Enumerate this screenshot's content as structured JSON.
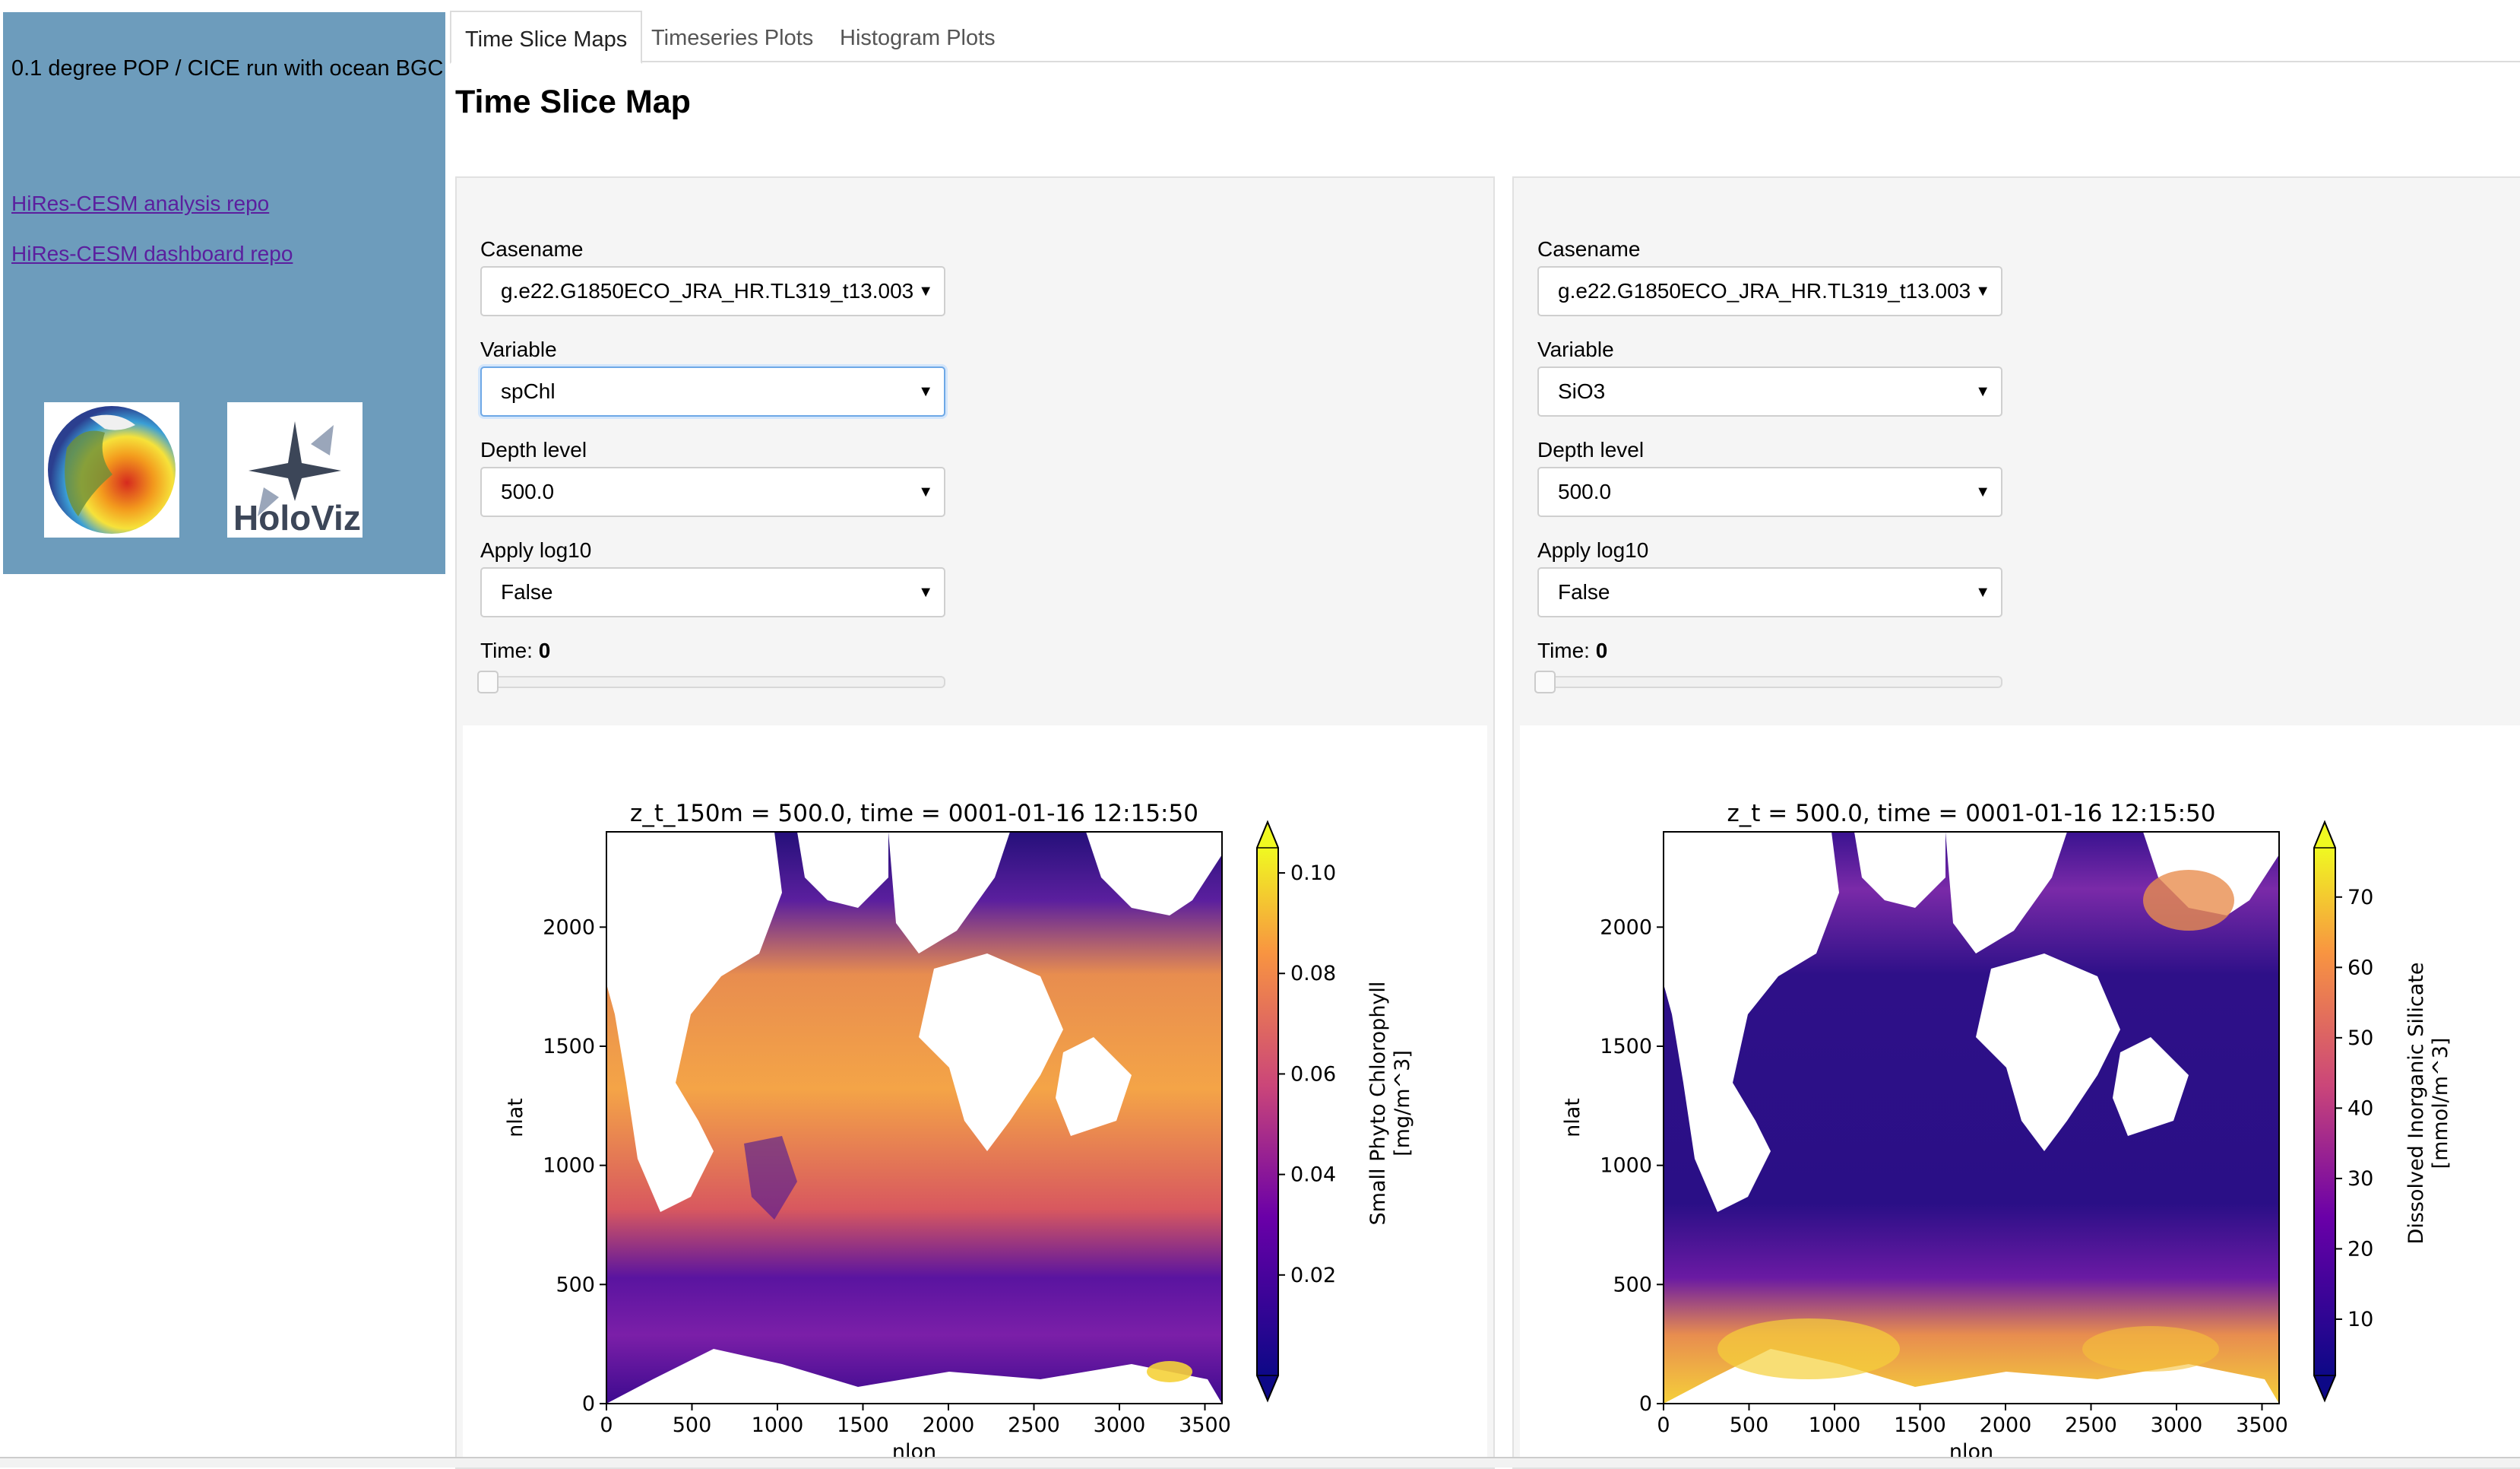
{
  "sidebar": {
    "title": "0.1 degree POP / CICE run with ocean BGC",
    "links": [
      "HiRes-CESM analysis repo",
      "HiRes-CESM dashboard repo"
    ],
    "logo_text": "HoloViz"
  },
  "tabs": [
    "Time Slice Maps",
    "Timeseries Plots",
    "Histogram Plots"
  ],
  "page_title": "Time Slice Map",
  "panels": [
    {
      "casename_label": "Casename",
      "casename_value": "g.e22.G1850ECO_JRA_HR.TL319_t13.003",
      "variable_label": "Variable",
      "variable_value": "spChl",
      "depth_label": "Depth level",
      "depth_value": "500.0",
      "log_label": "Apply log10",
      "log_value": "False",
      "time_label": "Time:",
      "time_value": "0",
      "plot_title": "z_t_150m = 500.0, time = 0001-01-16 12:15:50",
      "colorbar_label_1": "Small Phyto Chlorophyll",
      "colorbar_label_2": "[mg/m^3]"
    },
    {
      "casename_label": "Casename",
      "casename_value": "g.e22.G1850ECO_JRA_HR.TL319_t13.003",
      "variable_label": "Variable",
      "variable_value": "SiO3",
      "depth_label": "Depth level",
      "depth_value": "500.0",
      "log_label": "Apply log10",
      "log_value": "False",
      "time_label": "Time:",
      "time_value": "0",
      "plot_title": "z_t = 500.0, time = 0001-01-16 12:15:50",
      "colorbar_label_1": "Dissolved Inorganic Silicate",
      "colorbar_label_2": "[mmol/m^3]"
    }
  ],
  "chart_data": [
    {
      "type": "heatmap",
      "title": "z_t_150m = 500.0, time = 0001-01-16 12:15:50",
      "xlabel": "nlon",
      "ylabel": "nlat",
      "xlim": [
        0,
        3600
      ],
      "ylim": [
        0,
        2400
      ],
      "xticks": [
        0,
        500,
        1000,
        1500,
        2000,
        2500,
        3000,
        3500
      ],
      "yticks": [
        0,
        500,
        1000,
        1500,
        2000
      ],
      "colorbar": {
        "label": "Small Phyto Chlorophyll [mg/m^3]",
        "range": [
          0.0,
          0.105
        ],
        "ticks": [
          0.02,
          0.04,
          0.06,
          0.08,
          0.1
        ],
        "tick_labels": [
          "0.02",
          "0.04",
          "0.06",
          "0.08",
          "0.10"
        ],
        "colormap": "plasma"
      }
    },
    {
      "type": "heatmap",
      "title": "z_t = 500.0, time = 0001-01-16 12:15:50",
      "xlabel": "nlon",
      "ylabel": "nlat",
      "xlim": [
        0,
        3600
      ],
      "ylim": [
        0,
        2400
      ],
      "xticks": [
        0,
        500,
        1000,
        1500,
        2000,
        2500,
        3000,
        3500
      ],
      "yticks": [
        0,
        500,
        1000,
        1500,
        2000
      ],
      "colorbar": {
        "label": "Dissolved Inorganic Silicate [mmol/m^3]",
        "range": [
          2,
          77
        ],
        "ticks": [
          10,
          20,
          30,
          40,
          50,
          60,
          70
        ],
        "tick_labels": [
          "10",
          "20",
          "30",
          "40",
          "50",
          "60",
          "70"
        ],
        "colormap": "plasma"
      }
    }
  ],
  "colors": {
    "sidebar_bg": "#6d9cbc",
    "link": "#5b1f9e",
    "panel_bg": "#f5f5f5",
    "ocean_low": "#1f0c66",
    "ocean_mid": "#a43d9e",
    "ocean_high": "#f0b43a",
    "ocean_max": "#f5e83a"
  }
}
